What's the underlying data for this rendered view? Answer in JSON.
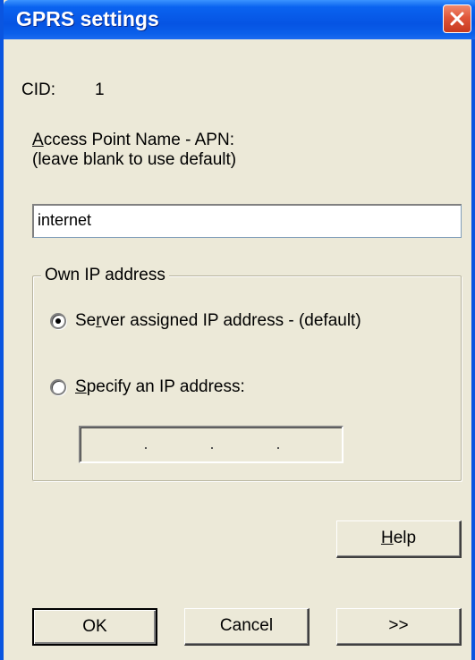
{
  "window": {
    "title": "GPRS settings"
  },
  "cid": {
    "label": "CID:",
    "value": "1"
  },
  "apn": {
    "label_first": "A",
    "label_rest": "ccess Point Name - APN:",
    "hint": "(leave blank to use default)",
    "value": "internet"
  },
  "own_ip": {
    "group_label": "Own IP address",
    "option_server_first": "Se",
    "option_server_ul": "r",
    "option_server_rest": "ver assigned IP address - (default)",
    "option_specify_ul": "S",
    "option_specify_rest": "pecify an IP address:",
    "selected": "server"
  },
  "buttons": {
    "help_ul": "H",
    "help_rest": "elp",
    "ok": "OK",
    "cancel": "Cancel",
    "more": ">>"
  },
  "icons": {
    "close": "close-icon"
  }
}
